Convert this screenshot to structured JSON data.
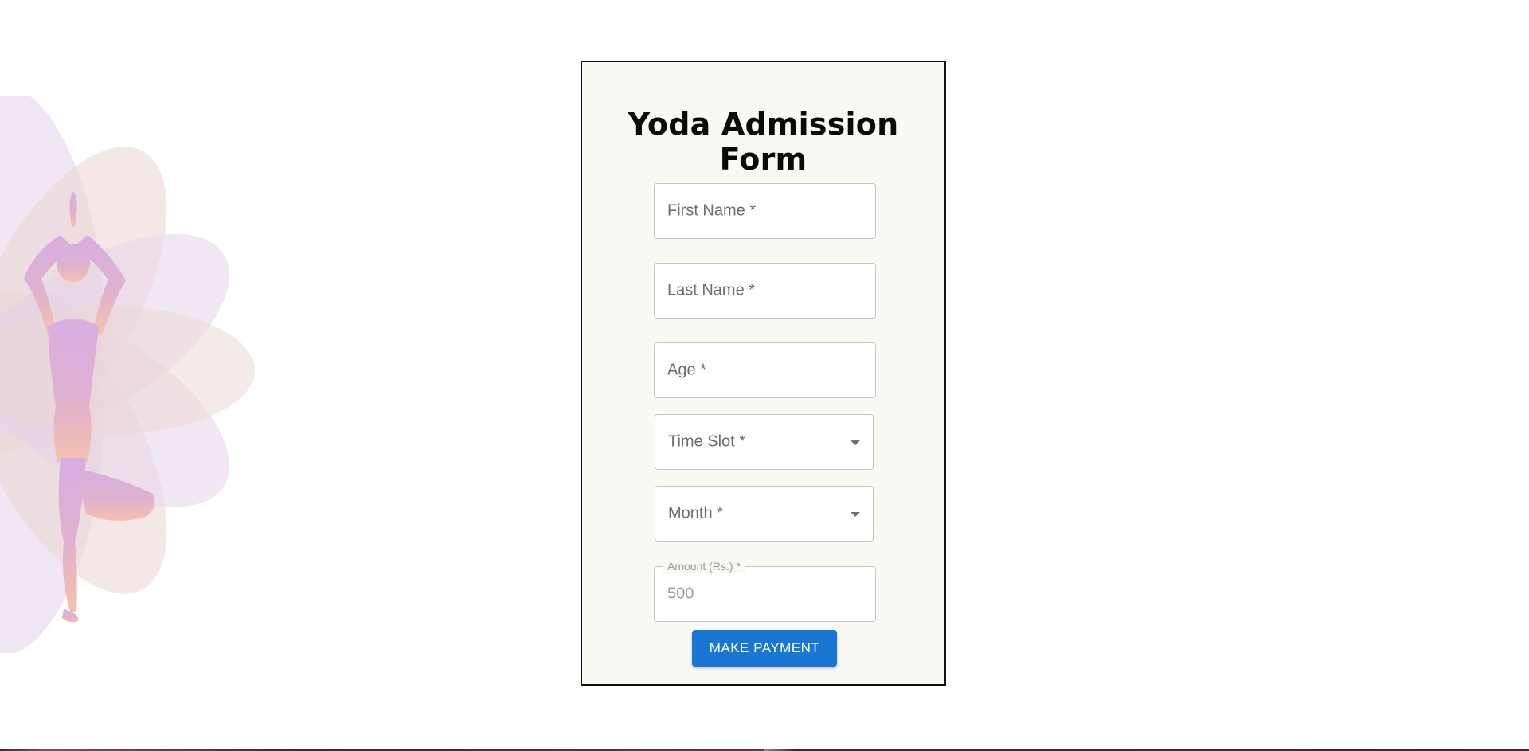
{
  "form": {
    "title": "Yoda Admission Form",
    "first_name_label": "First Name *",
    "last_name_label": "Last Name *",
    "age_label": "Age *",
    "time_slot_label": "Time Slot *",
    "month_label": "Month *",
    "amount_label": "Amount (Rs.) *",
    "amount_value": "500",
    "submit_label": "MAKE PAYMENT"
  },
  "icons": {
    "time_slot_dropdown": "chevron-down-icon",
    "month_dropdown": "chevron-down-icon",
    "illustration": "yoga-tree-pose-lotus-icon"
  },
  "colors": {
    "card_background": "#f9f8f3",
    "button": "#1976d2",
    "silhouette_top": "#d6aee0",
    "silhouette_bottom": "#f2bcb0"
  }
}
